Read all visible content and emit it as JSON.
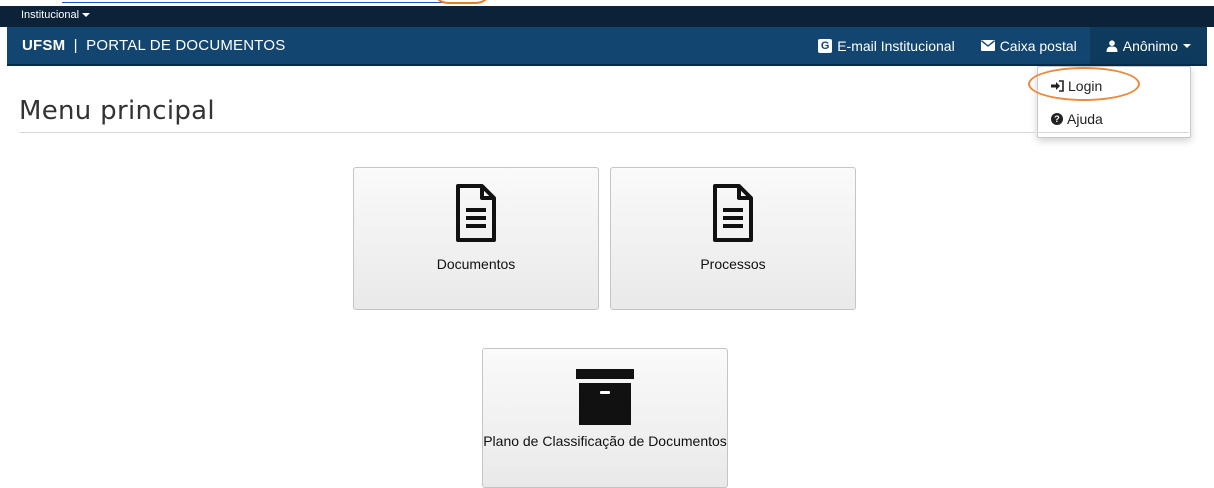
{
  "institutional": {
    "label": "Institucional"
  },
  "navbar": {
    "brand_strong": "UFSM",
    "brand_separator": "|",
    "brand_rest": "PORTAL DE DOCUMENTOS",
    "email_label": "E-mail Institucional",
    "email_icon": "google-g-icon",
    "mailbox_label": "Caixa postal",
    "mailbox_icon": "envelope-icon",
    "user_label": "Anônimo",
    "user_icon": "user-icon"
  },
  "user_menu": {
    "items": [
      {
        "label": "Login",
        "icon": "sign-in-icon"
      },
      {
        "label": "Ajuda",
        "icon": "question-circle-icon"
      }
    ]
  },
  "page": {
    "title": "Menu principal"
  },
  "tiles": [
    {
      "label": "Documentos",
      "icon": "document-icon"
    },
    {
      "label": "Processos",
      "icon": "document-icon"
    },
    {
      "label": "Plano de Classificação de Documentos",
      "icon": "archive-box-icon"
    }
  ],
  "colors": {
    "navbar": "#12456f",
    "institutional_bar": "#0b2239",
    "highlight": "#e98a3c"
  }
}
